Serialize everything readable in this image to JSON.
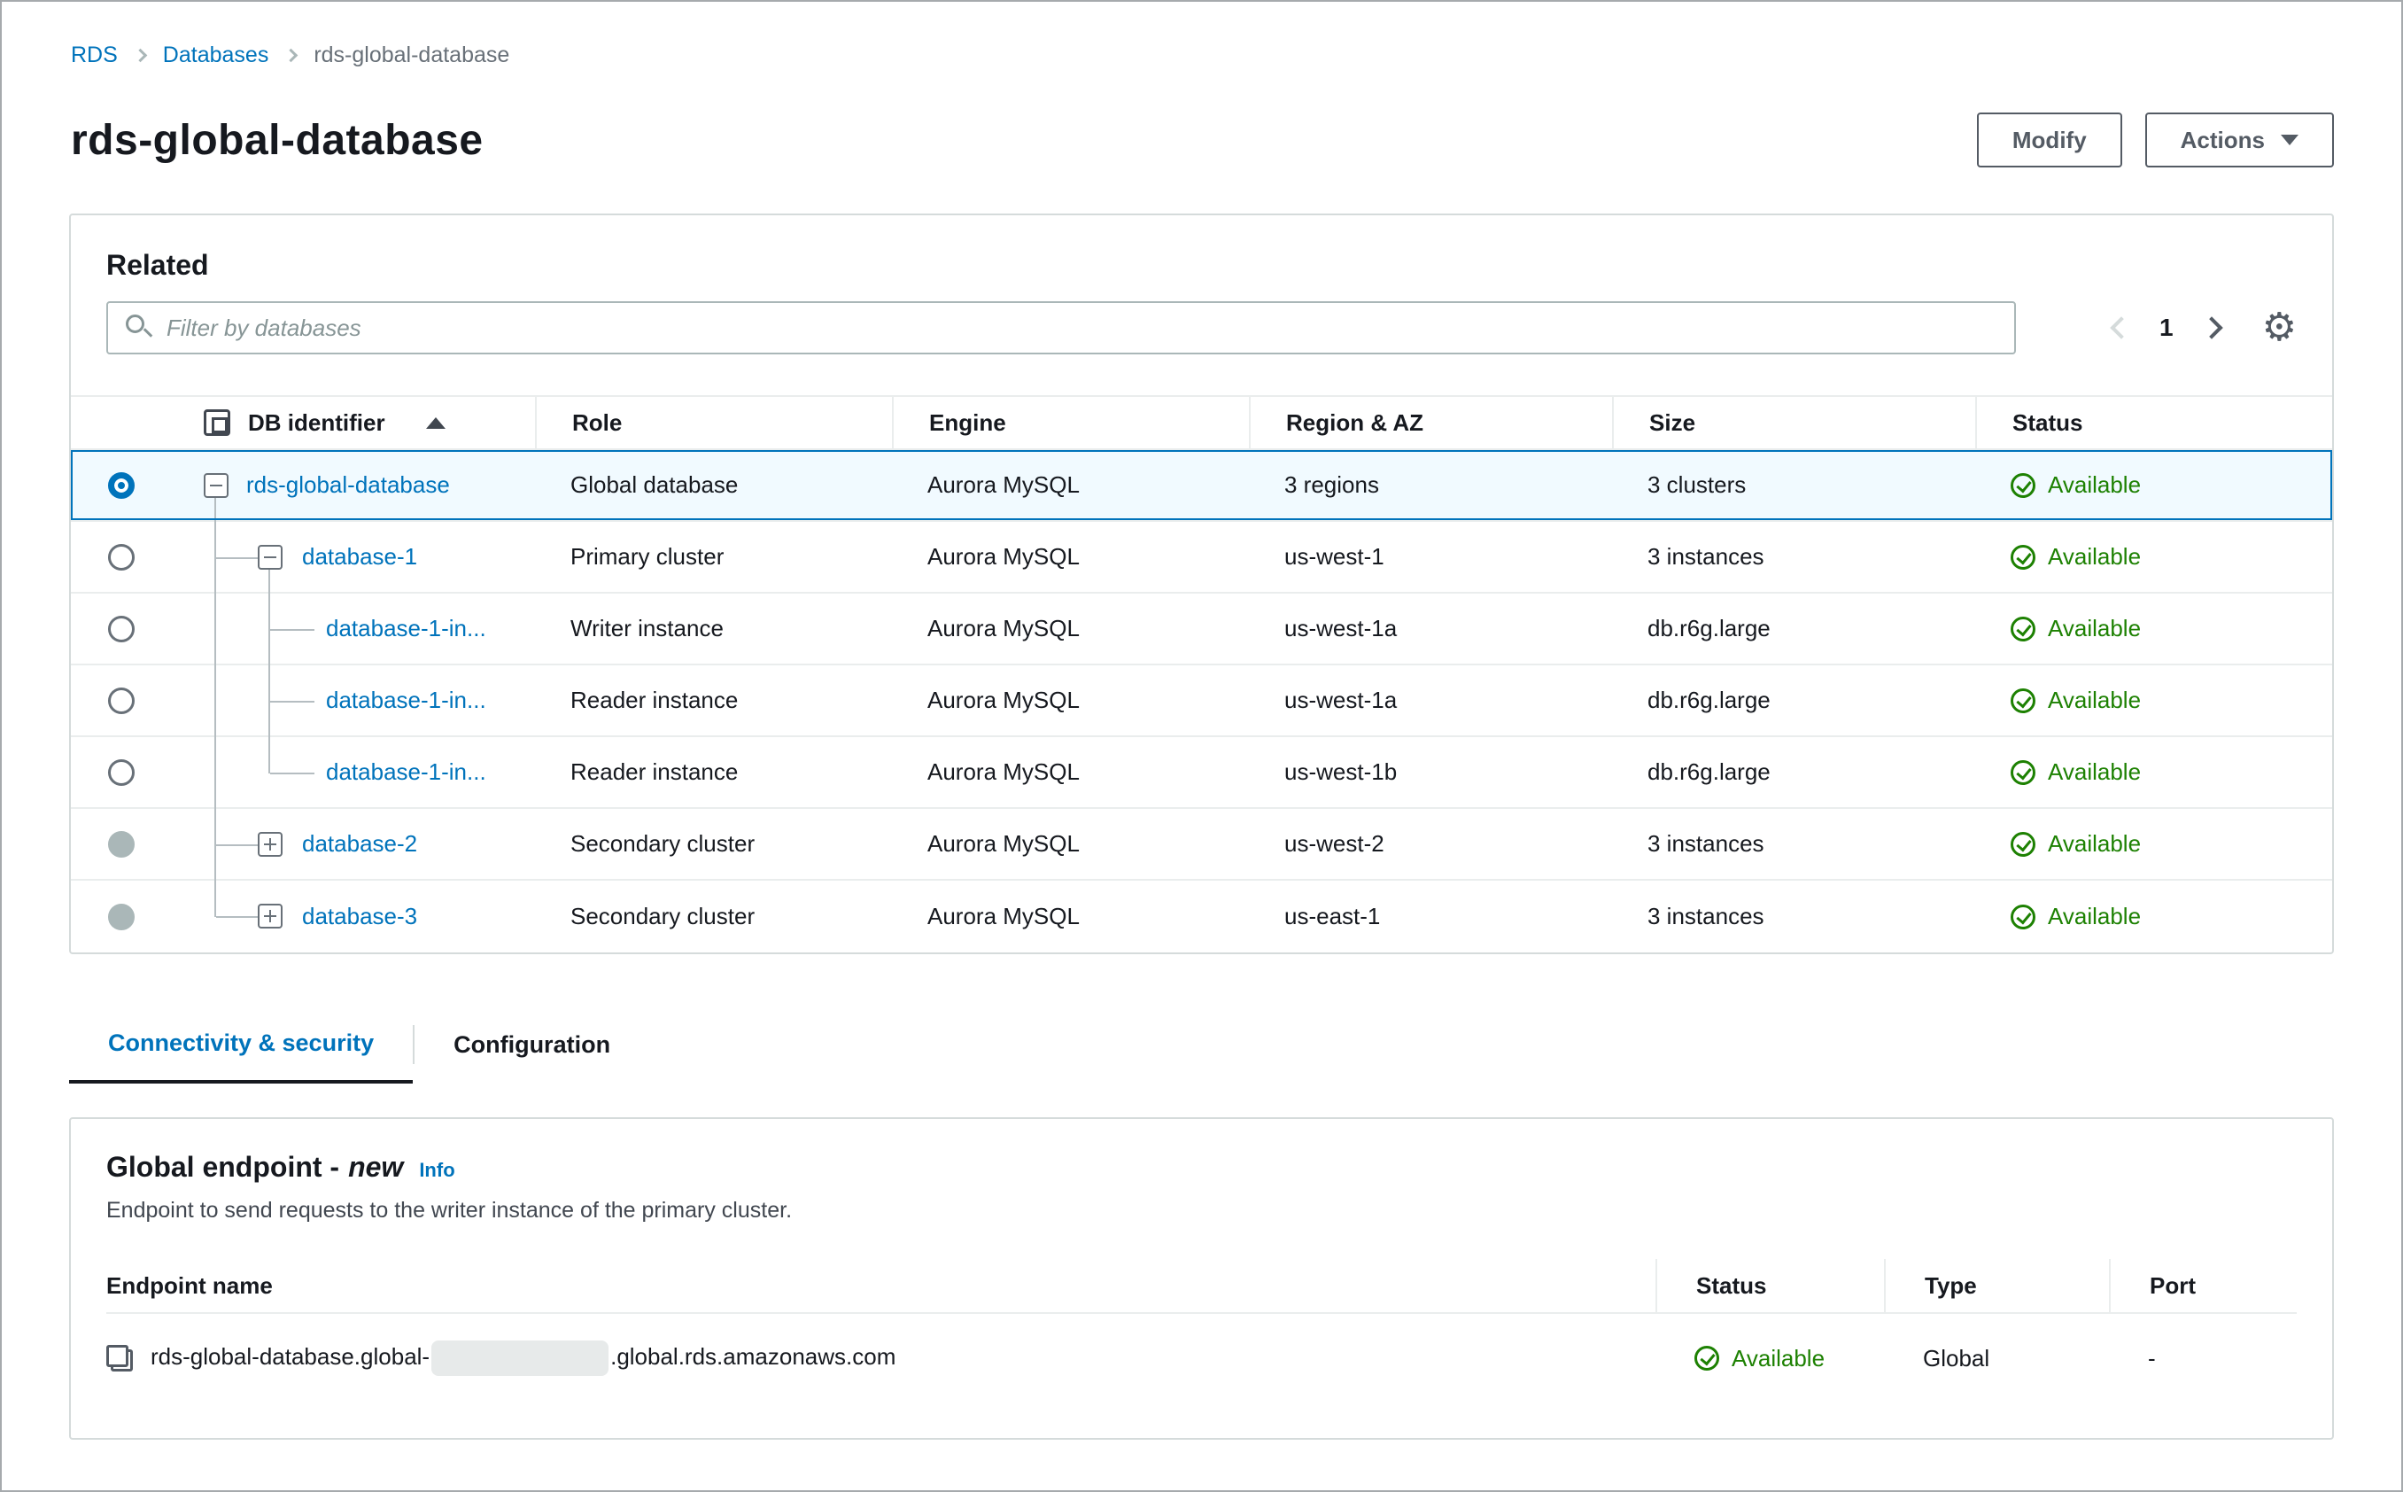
{
  "colors": {
    "link_blue": "#0073bb",
    "success_green": "#1d8102",
    "selected_row_bg": "#f1faff",
    "panel_border": "#d5dbdb",
    "text_dark": "#16191f"
  },
  "breadcrumb": {
    "items": [
      "RDS",
      "Databases"
    ],
    "current": "rds-global-database"
  },
  "page": {
    "title": "rds-global-database"
  },
  "toolbar": {
    "modify_label": "Modify",
    "actions_label": "Actions"
  },
  "related": {
    "title": "Related",
    "filter_placeholder": "Filter by databases",
    "pagination": {
      "page": "1"
    },
    "columns": {
      "db_identifier": "DB identifier",
      "role": "Role",
      "engine": "Engine",
      "region_az": "Region & AZ",
      "size": "Size",
      "status": "Status"
    },
    "rows": [
      {
        "id": "rds-global-database",
        "role": "Global database",
        "engine": "Aurora MySQL",
        "region": "3 regions",
        "size": "3 clusters",
        "status": "Available"
      },
      {
        "id": "database-1",
        "role": "Primary cluster",
        "engine": "Aurora MySQL",
        "region": "us-west-1",
        "size": "3 instances",
        "status": "Available"
      },
      {
        "id": "database-1-in...",
        "role": "Writer instance",
        "engine": "Aurora MySQL",
        "region": "us-west-1a",
        "size": "db.r6g.large",
        "status": "Available"
      },
      {
        "id": "database-1-in...",
        "role": "Reader instance",
        "engine": "Aurora MySQL",
        "region": "us-west-1a",
        "size": "db.r6g.large",
        "status": "Available"
      },
      {
        "id": "database-1-in...",
        "role": "Reader instance",
        "engine": "Aurora MySQL",
        "region": "us-west-1b",
        "size": "db.r6g.large",
        "status": "Available"
      },
      {
        "id": "database-2",
        "role": "Secondary cluster",
        "engine": "Aurora MySQL",
        "region": "us-west-2",
        "size": "3 instances",
        "status": "Available"
      },
      {
        "id": "database-3",
        "role": "Secondary cluster",
        "engine": "Aurora MySQL",
        "region": "us-east-1",
        "size": "3 instances",
        "status": "Available"
      }
    ]
  },
  "tabs": {
    "connectivity": "Connectivity & security",
    "configuration": "Configuration"
  },
  "global_endpoint": {
    "title": "Global endpoint -",
    "badge": "new",
    "info_label": "Info",
    "description": "Endpoint to send requests to the writer instance of the primary cluster.",
    "columns": {
      "endpoint_name": "Endpoint name",
      "status": "Status",
      "type": "Type",
      "port": "Port"
    },
    "row": {
      "name_prefix": "rds-global-database.global-",
      "name_suffix": ".global.rds.amazonaws.com",
      "status": "Available",
      "type": "Global",
      "port": "-"
    }
  }
}
